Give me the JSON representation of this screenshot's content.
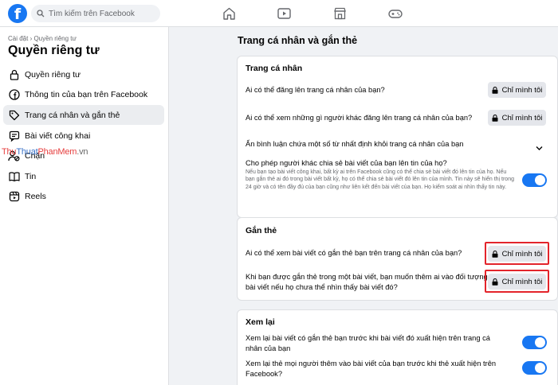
{
  "header": {
    "logo": "f",
    "search": {
      "placeholder": "Tìm kiếm trên Facebook"
    },
    "nav_icons": [
      "home-icon",
      "video-icon",
      "marketplace-icon",
      "gaming-icon"
    ]
  },
  "sidebar": {
    "breadcrumb": "Cài đặt › Quyền riêng tư",
    "title": "Quyền riêng tư",
    "items": [
      {
        "label": "Quyền riêng tư",
        "icon": "lock-icon"
      },
      {
        "label": "Thông tin của bạn trên Facebook",
        "icon": "facebook-icon"
      },
      {
        "label": "Trang cá nhân và gắn thẻ",
        "icon": "tag-icon",
        "active": true
      },
      {
        "label": "Bài viết công khai",
        "icon": "public-post-icon"
      },
      {
        "label": "Chặn",
        "icon": "block-icon"
      },
      {
        "label": "Tin",
        "icon": "book-icon"
      },
      {
        "label": "Reels",
        "icon": "reels-icon"
      }
    ],
    "watermark": {
      "part1": "Thu",
      "part2": "Thuat",
      "part3": "PhanMem",
      "part4": ".vn"
    }
  },
  "main": {
    "title": "Trang cá nhân và gắn thẻ",
    "sections": {
      "profile": {
        "title": "Trang cá nhân",
        "rows": [
          {
            "label": "Ai có thể đăng lên trang cá nhân của bạn?",
            "value": "Chỉ mình tôi"
          },
          {
            "label": "Ai có thể xem những gì người khác đăng lên trang cá nhân của bạn?",
            "value": "Chỉ mình tôi"
          },
          {
            "label": "Ẩn bình luận chứa một số từ nhất định khỏi trang cá nhân của bạn"
          },
          {
            "label": "Cho phép người khác chia sẻ bài viết của bạn lên tin của họ?",
            "desc": "Nếu bạn tạo bài viết công khai, bất kỳ ai trên Facebook cũng có thể chia sẻ bài viết đó lên tin của họ. Nếu bạn gắn thẻ ai đó trong bài viết bất kỳ, họ có thể chia sẻ bài viết đó lên tin của mình. Tin này sẽ hiển thị trong 24 giờ và có tên đầy đủ của bạn cũng như liên kết đến bài viết của bạn. Họ kiểm soát ai nhìn thấy tin này.",
            "toggle": true
          }
        ]
      },
      "tagging": {
        "title": "Gắn thẻ",
        "rows": [
          {
            "label": "Ai có thể xem bài viết có gắn thẻ bạn trên trang cá nhân của bạn?",
            "value": "Chỉ mình tôi"
          },
          {
            "label": "Khi bạn được gắn thẻ trong một bài viết, bạn muốn thêm ai vào đối tượng của bài viết nếu họ chưa thể nhìn thấy bài viết đó?",
            "value": "Chỉ mình tôi"
          }
        ]
      },
      "review": {
        "title": "Xem lại",
        "rows": [
          {
            "label": "Xem lại bài viết có gắn thẻ bạn trước khi bài viết đó xuất hiện trên trang cá nhân của bạn",
            "toggle": true
          },
          {
            "label": "Xem lại thẻ mọi người thêm vào bài viết của bạn trước khi thẻ xuất hiện trên Facebook?",
            "toggle": true
          }
        ]
      }
    }
  },
  "colors": {
    "accent": "#1877f2",
    "highlight": "#e3242b",
    "background": "#f0f2f5"
  }
}
